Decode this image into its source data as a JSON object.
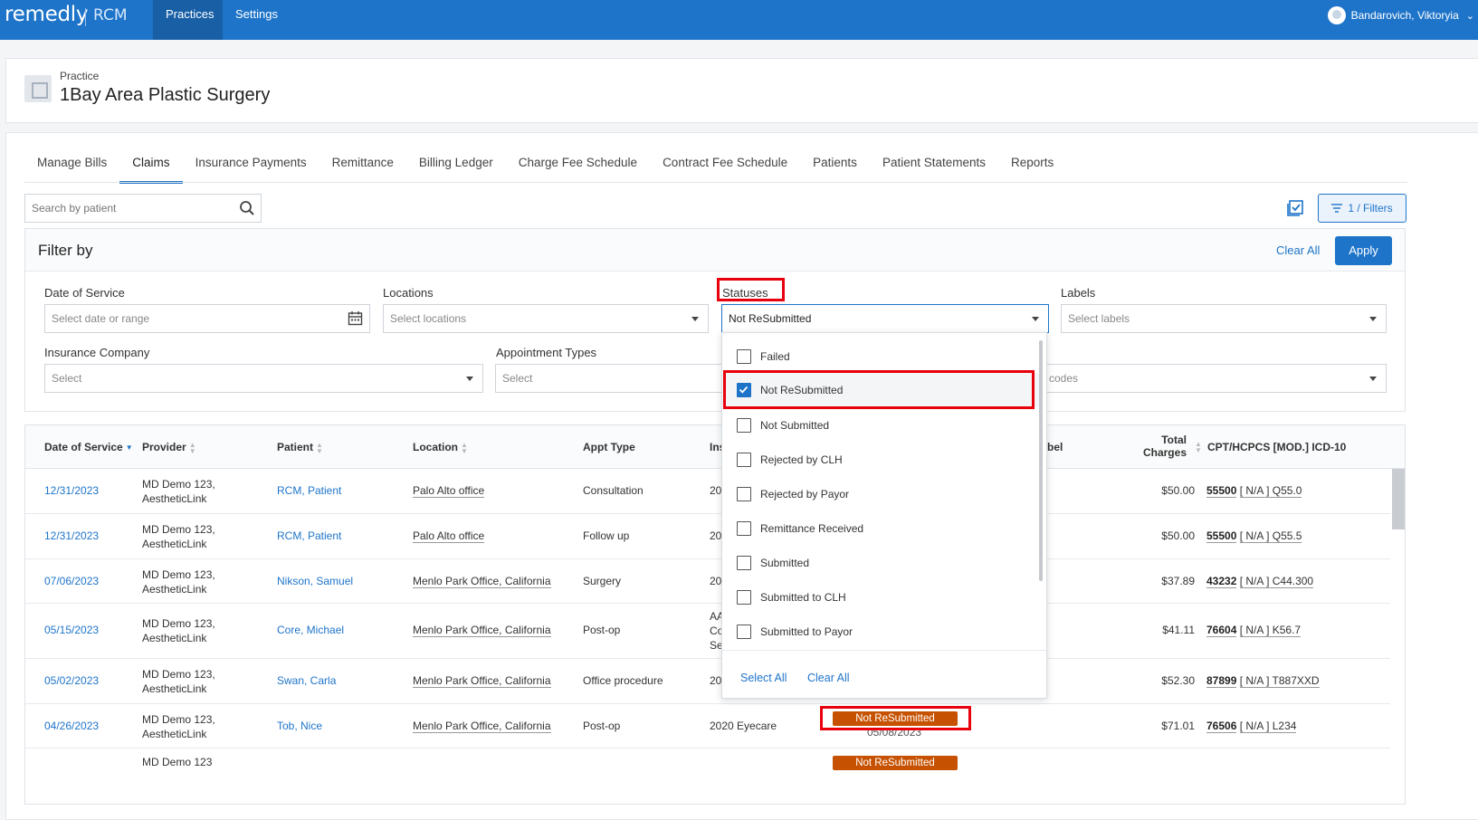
{
  "topbar": {
    "brand": "remedly",
    "brand_suffix": "RCM",
    "nav": [
      "Practices",
      "Settings"
    ],
    "user_name": "Bandarovich, Viktoryia"
  },
  "practice": {
    "label": "Practice",
    "name": "1Bay Area Plastic Surgery"
  },
  "tabs": [
    "Manage Bills",
    "Claims",
    "Insurance Payments",
    "Remittance",
    "Billing Ledger",
    "Charge Fee Schedule",
    "Contract Fee Schedule",
    "Patients",
    "Patient Statements",
    "Reports"
  ],
  "active_tab": "Claims",
  "search": {
    "placeholder": "Search by patient"
  },
  "filters_button": "1 / Filters",
  "filter_panel": {
    "title": "Filter by",
    "clear_all": "Clear All",
    "apply": "Apply",
    "date_of_service": {
      "label": "Date of Service",
      "placeholder": "Select date or range"
    },
    "locations": {
      "label": "Locations",
      "placeholder": "Select locations"
    },
    "statuses": {
      "label": "Statuses",
      "value": "Not ReSubmitted"
    },
    "labels": {
      "label": "Labels",
      "placeholder": "Select labels"
    },
    "insurance_company": {
      "label": "Insurance Company",
      "placeholder": "Select"
    },
    "appointment_types": {
      "label": "Appointment Types",
      "placeholder": "Select"
    },
    "codes": {
      "placeholder_partial": "codes"
    }
  },
  "status_dropdown": {
    "options": [
      {
        "label": "Failed",
        "checked": false
      },
      {
        "label": "Not ReSubmitted",
        "checked": true
      },
      {
        "label": "Not Submitted",
        "checked": false
      },
      {
        "label": "Rejected by CLH",
        "checked": false
      },
      {
        "label": "Rejected by Payor",
        "checked": false
      },
      {
        "label": "Remittance Received",
        "checked": false
      },
      {
        "label": "Submitted",
        "checked": false
      },
      {
        "label": "Submitted to CLH",
        "checked": false
      },
      {
        "label": "Submitted to Payor",
        "checked": false
      }
    ],
    "select_all": "Select All",
    "clear_all": "Clear All"
  },
  "table": {
    "headers": {
      "date": "Date of Service",
      "provider": "Provider",
      "patient": "Patient",
      "location": "Location",
      "appt": "Appt Type",
      "ins_partial": "Ins",
      "label_partial": "bel",
      "total_1": "Total",
      "total_2": "Charges",
      "codes": "CPT/HCPCS [MOD.] ICD-10"
    },
    "rows": [
      {
        "date": "12/31/2023",
        "provider_1": "MD Demo 123,",
        "provider_2": "AestheticLink",
        "patient": "RCM, Patient",
        "location": "Palo Alto office",
        "appt": "Consultation",
        "ins": "20",
        "total": "$50.00",
        "cpt": "55500",
        "rest": "[ N/A ] Q55.0"
      },
      {
        "date": "12/31/2023",
        "provider_1": "MD Demo 123,",
        "provider_2": "AestheticLink",
        "patient": "RCM, Patient",
        "location": "Palo Alto office",
        "appt": "Follow up",
        "ins": "20",
        "total": "$50.00",
        "cpt": "55500",
        "rest": "[ N/A ] Q55.5"
      },
      {
        "date": "07/06/2023",
        "provider_1": "MD Demo 123,",
        "provider_2": "AestheticLink",
        "patient": "Nikson, Samuel",
        "location": "Menlo Park Office, California",
        "appt": "Surgery",
        "ins": "20",
        "total": "$37.89",
        "cpt": "43232",
        "rest": "[ N/A ] C44.300"
      },
      {
        "date": "05/15/2023",
        "provider_1": "MD Demo 123,",
        "provider_2": "AestheticLink",
        "patient": "Core, Michael",
        "location": "Menlo Park Office, California",
        "appt": "Post-op",
        "ins_1": "AA",
        "ins_2": "Co",
        "ins_3": "Se",
        "total": "$41.11",
        "cpt": "76604",
        "rest": "[ N/A ] K56.7"
      },
      {
        "date": "05/02/2023",
        "provider_1": "MD Demo 123,",
        "provider_2": "AestheticLink",
        "patient": "Swan, Carla",
        "location": "Menlo Park Office, California",
        "appt": "Office procedure",
        "ins": "20",
        "total": "$52.30",
        "cpt": "87899",
        "rest": "[ N/A ] T887XXD"
      },
      {
        "date": "04/26/2023",
        "provider_1": "MD Demo 123,",
        "provider_2": "AestheticLink",
        "patient": "Tob, Nice",
        "location": "Menlo Park Office, California",
        "appt": "Post-op",
        "ins": "2020 Eyecare",
        "status": "Not ReSubmitted",
        "status_date": "05/08/2023",
        "total": "$71.01",
        "cpt": "76506",
        "rest": "[ N/A ] L234"
      },
      {
        "provider_1": "MD Demo 123",
        "status": "Not ReSubmitted"
      }
    ]
  },
  "colors": {
    "brand": "#1e74c9",
    "status": "#c65100",
    "highlight": "#e8000d"
  }
}
